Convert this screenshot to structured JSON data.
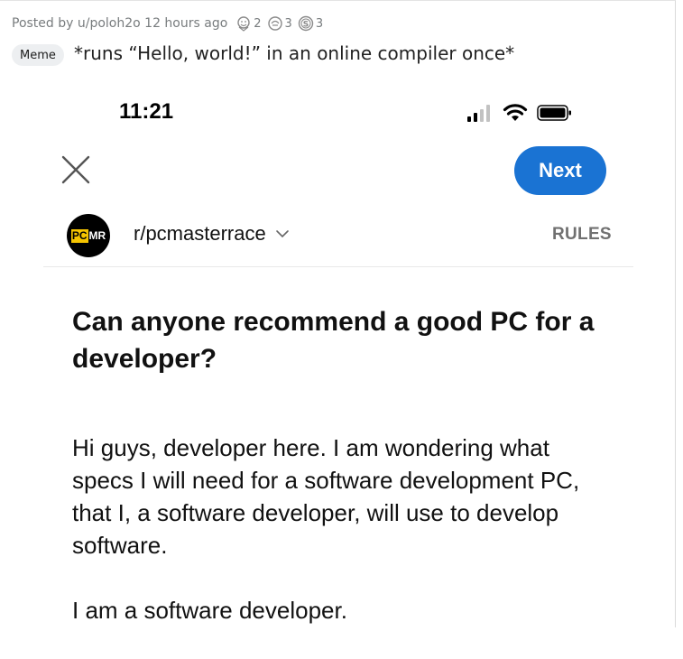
{
  "post": {
    "posted_by": "Posted by u/poloh2o 12 hours ago",
    "awards": [
      {
        "icon": "wholesome-award-icon",
        "count": "2"
      },
      {
        "icon": "helpful-award-icon",
        "count": "3"
      },
      {
        "icon": "silver-coin-award-icon",
        "count": "3"
      }
    ],
    "flair": "Meme",
    "title": "*runs “Hello, world!” in an online compiler once*"
  },
  "screenshot": {
    "status_bar": {
      "time": "11:21",
      "icons": [
        "cellular-signal-icon",
        "wifi-icon",
        "battery-icon"
      ]
    },
    "toolbar": {
      "close_icon": "close-icon",
      "next_label": "Next",
      "next_color": "#1a73d3"
    },
    "community": {
      "avatar_part1": "PC",
      "avatar_part2": "MR",
      "name": "r/pcmasterrace",
      "dropdown_icon": "chevron-down-icon",
      "rules_label": "RULES"
    },
    "draft": {
      "title": "Can anyone recommend a good PC for a developer?",
      "body": [
        "Hi guys, developer here. I am wondering what specs I will need for a software development PC, that I, a software developer, will use to develop software.",
        "I am a software developer."
      ]
    }
  }
}
